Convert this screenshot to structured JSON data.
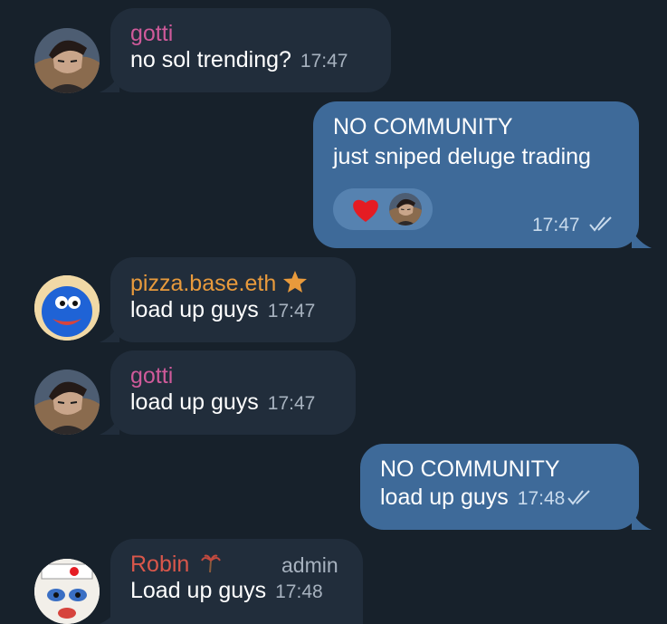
{
  "messages": [
    {
      "sender": "gotti",
      "text": "no sol trending?",
      "time": "17:47",
      "avatar": "anime-character-avatar"
    },
    {
      "sender": "NO COMMUNITY",
      "text": "just sniped deluge trading",
      "time": "17:47",
      "reaction": "heart"
    },
    {
      "sender": "pizza.base.eth",
      "text": "load up guys",
      "time": "17:47",
      "avatar": "blue-frog-avatar",
      "badge": "star"
    },
    {
      "sender": "gotti",
      "text": "load up guys",
      "time": "17:47",
      "avatar": "anime-character-avatar"
    },
    {
      "sender": "NO COMMUNITY",
      "text": "load up guys",
      "time": "17:48"
    },
    {
      "sender": "Robin",
      "role": "admin",
      "text": "Load up guys",
      "time": "17:48",
      "avatar": "clown-mask-avatar",
      "badge": "palm-tree"
    }
  ],
  "colors": {
    "background": "#17212b",
    "incoming_bubble": "#212d3b",
    "outgoing_bubble": "#3e6a99"
  }
}
